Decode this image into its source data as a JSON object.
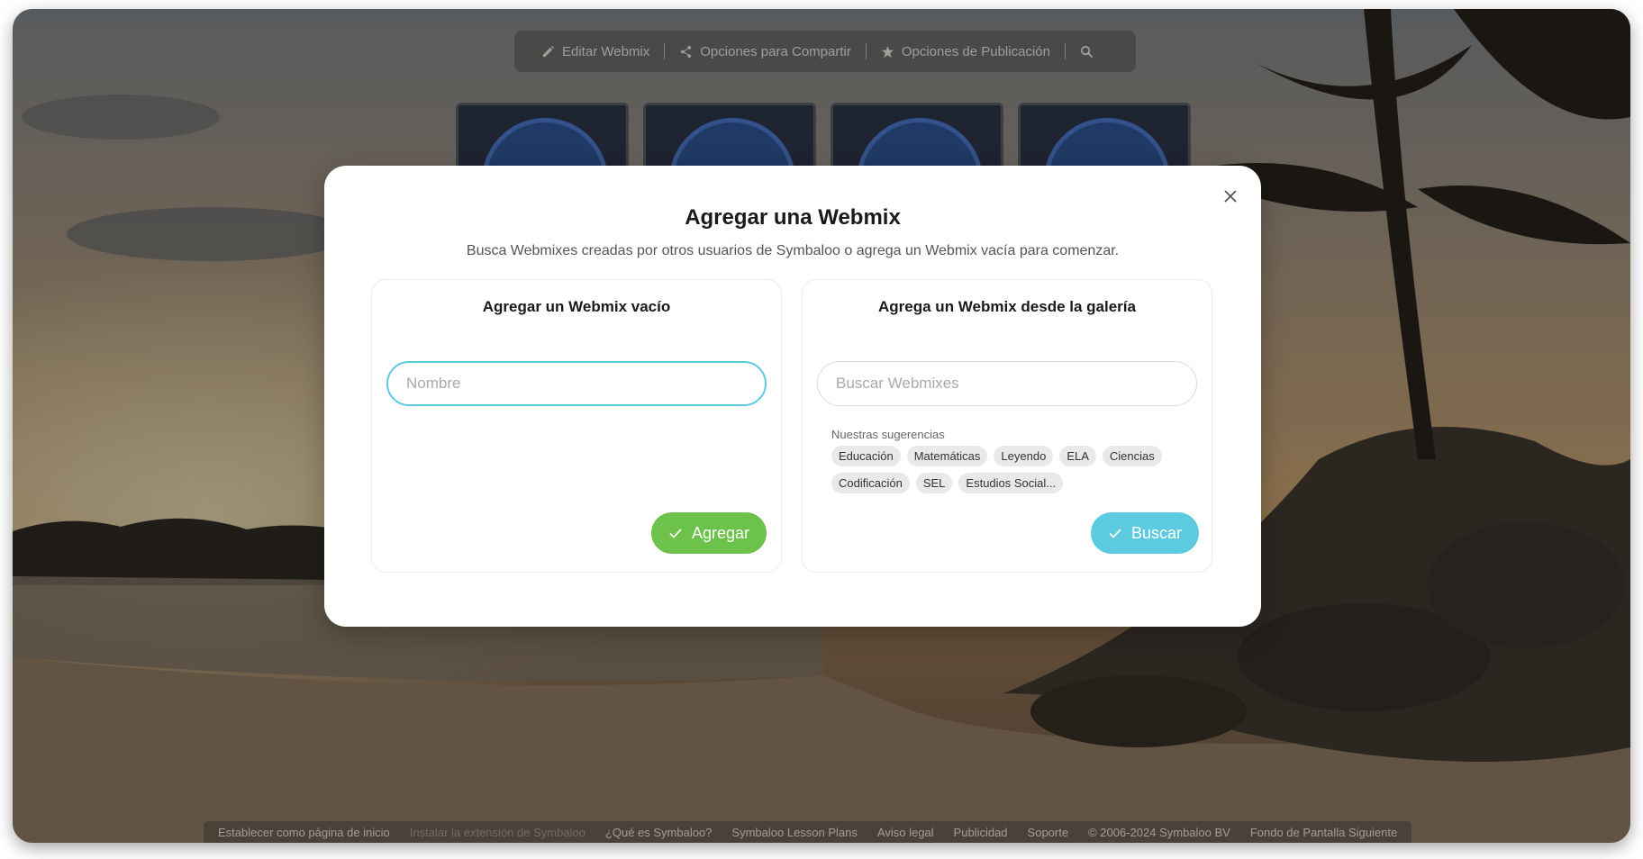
{
  "toolbar": {
    "edit_label": "Editar Webmix",
    "share_label": "Opciones para Compartir",
    "publish_label": "Opciones de Publicación"
  },
  "icons": {
    "edit": "pencil-icon",
    "share": "share-icon",
    "publish": "star-icon",
    "search": "search-icon",
    "close": "close-icon",
    "check": "check-icon"
  },
  "colors": {
    "add_button": "#6cc24a",
    "search_button": "#5ccbe0",
    "input_focus": "#5ccbe0"
  },
  "modal": {
    "title": "Agregar una Webmix",
    "subtitle": "Busca Webmixes creadas por otros usuarios de Symbaloo o agrega un Webmix vacía para comenzar.",
    "left_panel": {
      "title": "Agregar un Webmix vacío",
      "name_placeholder": "Nombre",
      "add_label": "Agregar"
    },
    "right_panel": {
      "title": "Agrega un Webmix desde la galería",
      "search_placeholder": "Buscar Webmixes",
      "suggestions_label": "Nuestras sugerencias",
      "suggestions": [
        "Educación",
        "Matemáticas",
        "Leyendo",
        "ELA",
        "Ciencias",
        "Codificación",
        "SEL",
        "Estudios Social..."
      ],
      "search_label": "Buscar"
    }
  },
  "footer": {
    "links": [
      "Establecer como página de inicio",
      "Instalar la extensión de Symbaloo",
      "¿Qué es Symbaloo?",
      "Symbaloo Lesson Plans",
      "Aviso legal",
      "Publicidad",
      "Soporte",
      "© 2006-2024 Symbaloo BV",
      "Fondo de Pantalla Siguiente"
    ]
  }
}
